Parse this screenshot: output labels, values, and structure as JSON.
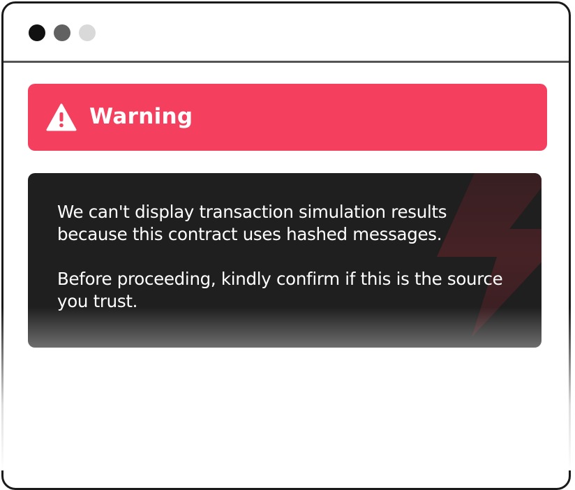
{
  "window": {
    "controls": [
      {
        "name": "close",
        "color": "#111111"
      },
      {
        "name": "minimize",
        "color": "#616161"
      },
      {
        "name": "maximize",
        "color": "#d9d9d9"
      }
    ]
  },
  "banner": {
    "icon": "warning-triangle-icon",
    "title": "Warning",
    "color": "#f43f5e"
  },
  "message": {
    "background": "#1f1f1f",
    "decoration_icon": "lightning-bolt-icon",
    "paragraphs": [
      "We can't display transaction simulation results because this contract uses hashed messages.",
      "Before proceeding, kindly confirm if this is the source you trust."
    ]
  }
}
